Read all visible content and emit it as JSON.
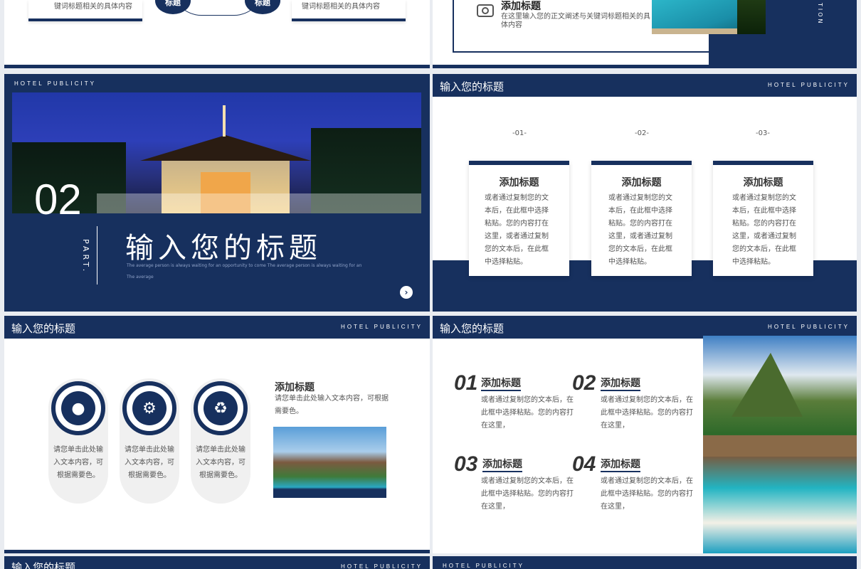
{
  "colors": {
    "navy": "#17305e",
    "white": "#ffffff",
    "gray": "#f0f0f0"
  },
  "top_left": {
    "left_text": "键词标题相关的具体内容",
    "right_text": "键词标题相关的具体内容",
    "badge_left": "标题",
    "badge_right": "标题"
  },
  "top_right": {
    "title": "添加标题",
    "desc": "在这里输入您的正文阐述与关键词标题相关的具体内容",
    "side_text": "TION",
    "icon": "camera-icon"
  },
  "part_slide": {
    "kicker": "HOTEL PUBLICITY",
    "number": "02",
    "part_label": "PART.",
    "title": "输入您的标题",
    "subtitle": "The average person is always waiting for an opportunity to come The average person is always waiting for an The average",
    "next_icon": "chevron-right-icon"
  },
  "three_cards": {
    "header": "输入您的标题",
    "kicker": "HOTEL PUBLICITY",
    "cards": [
      {
        "index": "-01-",
        "title": "添加标题",
        "body": "或者通过复制您的文本后，在此框中选择粘贴。您的内容打在这里，或者通过复制您的文本后，在此框中选择粘贴。"
      },
      {
        "index": "-02-",
        "title": "添加标题",
        "body": "或者通过复制您的文本后，在此框中选择粘贴。您的内容打在这里，或者通过复制您的文本后，在此框中选择粘贴。"
      },
      {
        "index": "-03-",
        "title": "添加标题",
        "body": "或者通过复制您的文本后，在此框中选择粘贴。您的内容打在这里，或者通过复制您的文本后，在此框中选择粘贴。"
      }
    ]
  },
  "icons_slide": {
    "header": "输入您的标题",
    "kicker": "HOTEL PUBLICITY",
    "pills": [
      {
        "icon": "user-icon",
        "text": "请您单击此处输入文本内容，可根据需要色。"
      },
      {
        "icon": "worker-icon",
        "text": "请您单击此处输入文本内容，可根据需要色。"
      },
      {
        "icon": "recycle-icon",
        "text": "请您单击此处输入文本内容，可根据需要色。"
      }
    ],
    "side_title": "添加标题",
    "side_text": "请您单击此处输入文本内容，可根据需要色。"
  },
  "numbered_slide": {
    "header": "输入您的标题",
    "kicker": "HOTEL PUBLICITY",
    "items": [
      {
        "num": "01",
        "title": "添加标题",
        "body": "或者通过复制您的文本后，在此框中选择粘贴。您的内容打在这里，"
      },
      {
        "num": "02",
        "title": "添加标题",
        "body": "或者通过复制您的文本后，在此框中选择粘贴。您的内容打在这里，"
      },
      {
        "num": "03",
        "title": "添加标题",
        "body": "或者通过复制您的文本后，在此框中选择粘贴。您的内容打在这里，"
      },
      {
        "num": "04",
        "title": "添加标题",
        "body": "或者通过复制您的文本后，在此框中选择粘贴。您的内容打在这里，"
      }
    ]
  },
  "bottom_left": {
    "header": "输入您的标题",
    "kicker": "HOTEL PUBLICITY"
  },
  "bottom_right": {
    "kicker": "HOTEL PUBLICITY"
  }
}
